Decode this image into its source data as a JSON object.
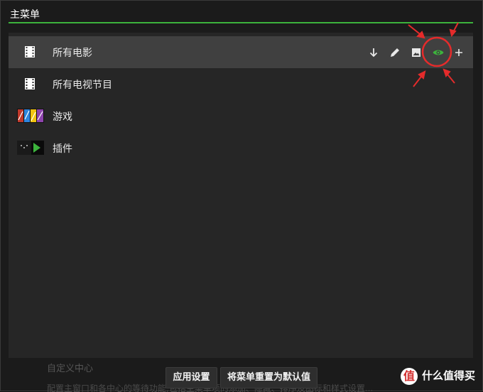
{
  "main_menu": {
    "title": "主菜单",
    "items": [
      {
        "label": "所有电影",
        "icon": "film-strip-icon",
        "active": true
      },
      {
        "label": "所有电视节目",
        "icon": "film-strip-icon",
        "active": false
      },
      {
        "label": "游戏",
        "icon": "games-thumbnail-icon",
        "active": false
      },
      {
        "label": "插件",
        "icon": "addons-thumbnail-icon",
        "active": false
      }
    ],
    "row_actions": [
      "move-down-icon",
      "edit-pencil-icon",
      "image-icon",
      "visibility-eye-icon",
      "add-plus-icon"
    ]
  },
  "background": {
    "section_title": "自定义中心",
    "description": "配置主窗口和各中心的等待功能,包括主菜单项的添加、隐藏、排序及图标和样式设置..."
  },
  "footer": {
    "apply_label": "应用设置",
    "reset_label": "将菜单重置为默认值"
  },
  "watermark": {
    "text": "什么值得买",
    "badge": "值"
  },
  "colors": {
    "accent": "#3cb33c",
    "highlight_circle": "#e52b2b",
    "active_row": "#404040",
    "panel": "#262626"
  }
}
